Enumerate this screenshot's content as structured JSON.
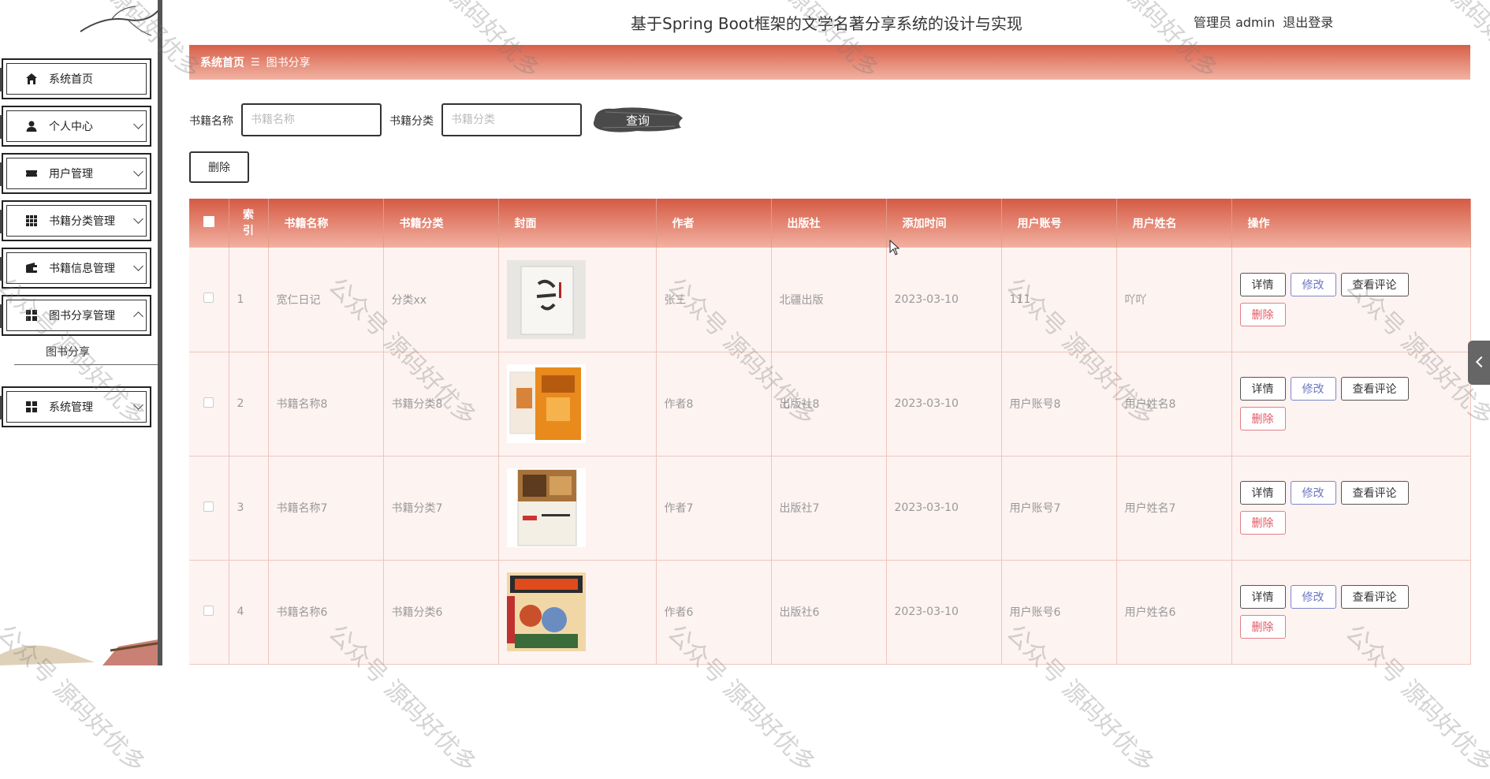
{
  "header": {
    "title": "基于Spring Boot框架的文学名著分享系统的设计与实现",
    "user": "管理员 admin",
    "logout": "退出登录"
  },
  "sidebar": {
    "items": [
      {
        "label": "系统首页",
        "icon": "home-icon"
      },
      {
        "label": "个人中心",
        "icon": "person-icon"
      },
      {
        "label": "用户管理",
        "icon": "ticket-icon"
      },
      {
        "label": "书籍分类管理",
        "icon": "grid-icon"
      },
      {
        "label": "书籍信息管理",
        "icon": "wallet-icon"
      },
      {
        "label": "图书分享管理",
        "icon": "apps-icon"
      },
      {
        "label": "系统管理",
        "icon": "apps-icon"
      }
    ],
    "sub_item": "图书分享"
  },
  "breadcrumb": {
    "home": "系统首页",
    "separator": "☰",
    "current": "图书分享"
  },
  "search": {
    "name_label": "书籍名称",
    "name_placeholder": "书籍名称",
    "category_label": "书籍分类",
    "category_placeholder": "书籍分类",
    "query_button": "查询"
  },
  "toolbar": {
    "delete_button": "删除"
  },
  "table": {
    "columns": [
      "索引",
      "书籍名称",
      "书籍分类",
      "封面",
      "作者",
      "出版社",
      "添加时间",
      "用户账号",
      "用户姓名",
      "操作"
    ],
    "index_header_line1": "索",
    "index_header_line2": "引",
    "actions": {
      "detail": "详情",
      "edit": "修改",
      "comments": "查看评论",
      "delete": "删除"
    },
    "rows": [
      {
        "index": "1",
        "name": "宽仁日记",
        "category": "分类xx",
        "author": "张三",
        "publisher": "北疆出版",
        "time": "2023-03-10",
        "account": "111",
        "username": "吖吖"
      },
      {
        "index": "2",
        "name": "书籍名称8",
        "category": "书籍分类8",
        "author": "作者8",
        "publisher": "出版社8",
        "time": "2023-03-10",
        "account": "用户账号8",
        "username": "用户姓名8"
      },
      {
        "index": "3",
        "name": "书籍名称7",
        "category": "书籍分类7",
        "author": "作者7",
        "publisher": "出版社7",
        "time": "2023-03-10",
        "account": "用户账号7",
        "username": "用户姓名7"
      },
      {
        "index": "4",
        "name": "书籍名称6",
        "category": "书籍分类6",
        "author": "作者6",
        "publisher": "出版社6",
        "time": "2023-03-10",
        "account": "用户账号6",
        "username": "用户姓名6"
      }
    ]
  },
  "watermark": "公众号 源码好优多",
  "colors": {
    "accent": "#d75f49",
    "accent_light": "#f2b3a3",
    "row_bg": "#fdf3f1",
    "edit": "#6b75c0",
    "danger": "#e05a66"
  }
}
